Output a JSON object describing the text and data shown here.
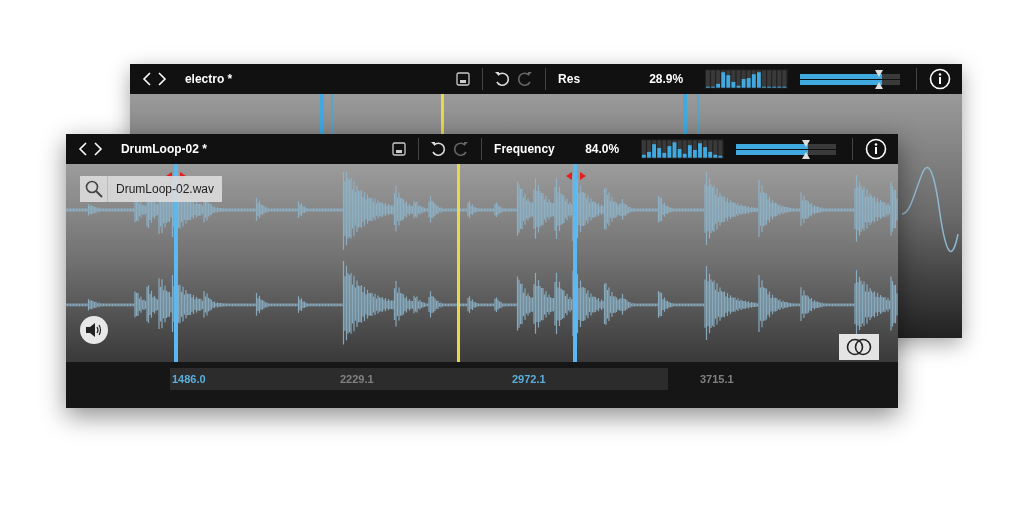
{
  "windows": [
    {
      "title": "electro *",
      "parameter": {
        "label": "Res",
        "value": "28.9%"
      },
      "sliders": [
        {
          "level": 0.82
        },
        {
          "level": 0.82
        }
      ]
    },
    {
      "title": "DrumLoop-02 *",
      "parameter": {
        "label": "Frequency",
        "value": "84.0%"
      },
      "sliders": [
        {
          "level": 0.72
        },
        {
          "level": 0.72
        }
      ],
      "file_label": "DrumLoop-02.wav",
      "ruler": [
        {
          "label": "1486.0",
          "highlighted": true
        },
        {
          "label": "2229.1",
          "highlighted": false
        },
        {
          "label": "2972.1",
          "highlighted": true
        },
        {
          "label": "3715.1",
          "highlighted": false
        }
      ]
    }
  ]
}
